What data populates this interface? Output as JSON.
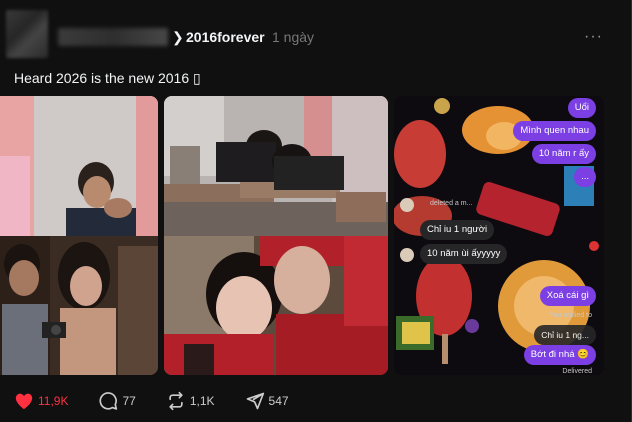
{
  "post": {
    "username": "2016forever",
    "timestamp": "1 ngày",
    "caption": "Heard 2026 is the new 2016 ▯",
    "more_label": "···"
  },
  "chat": {
    "messages_right_top": [
      "Uổi",
      "Mình quen nhau",
      "10 năm r ấy",
      "..."
    ],
    "deleted_note": "deleted a m...",
    "messages_left": [
      "Chỉ iu 1 người",
      "10 năm ùi ấyyyyy"
    ],
    "messages_right_bottom": [
      "Xoá cái gì"
    ],
    "replied_note": "You replied to",
    "quoted_message": "Chỉ iu 1 ng...",
    "last_message": "Bớt đi nhá 😊",
    "delivered": "Delivered"
  },
  "actions": {
    "likes": "11,9K",
    "comments": "77",
    "reposts": "1,1K",
    "shares": "547"
  },
  "colors": {
    "like": "#ff3040",
    "bubble_purple": "#7b3fe4",
    "background": "#101010"
  }
}
